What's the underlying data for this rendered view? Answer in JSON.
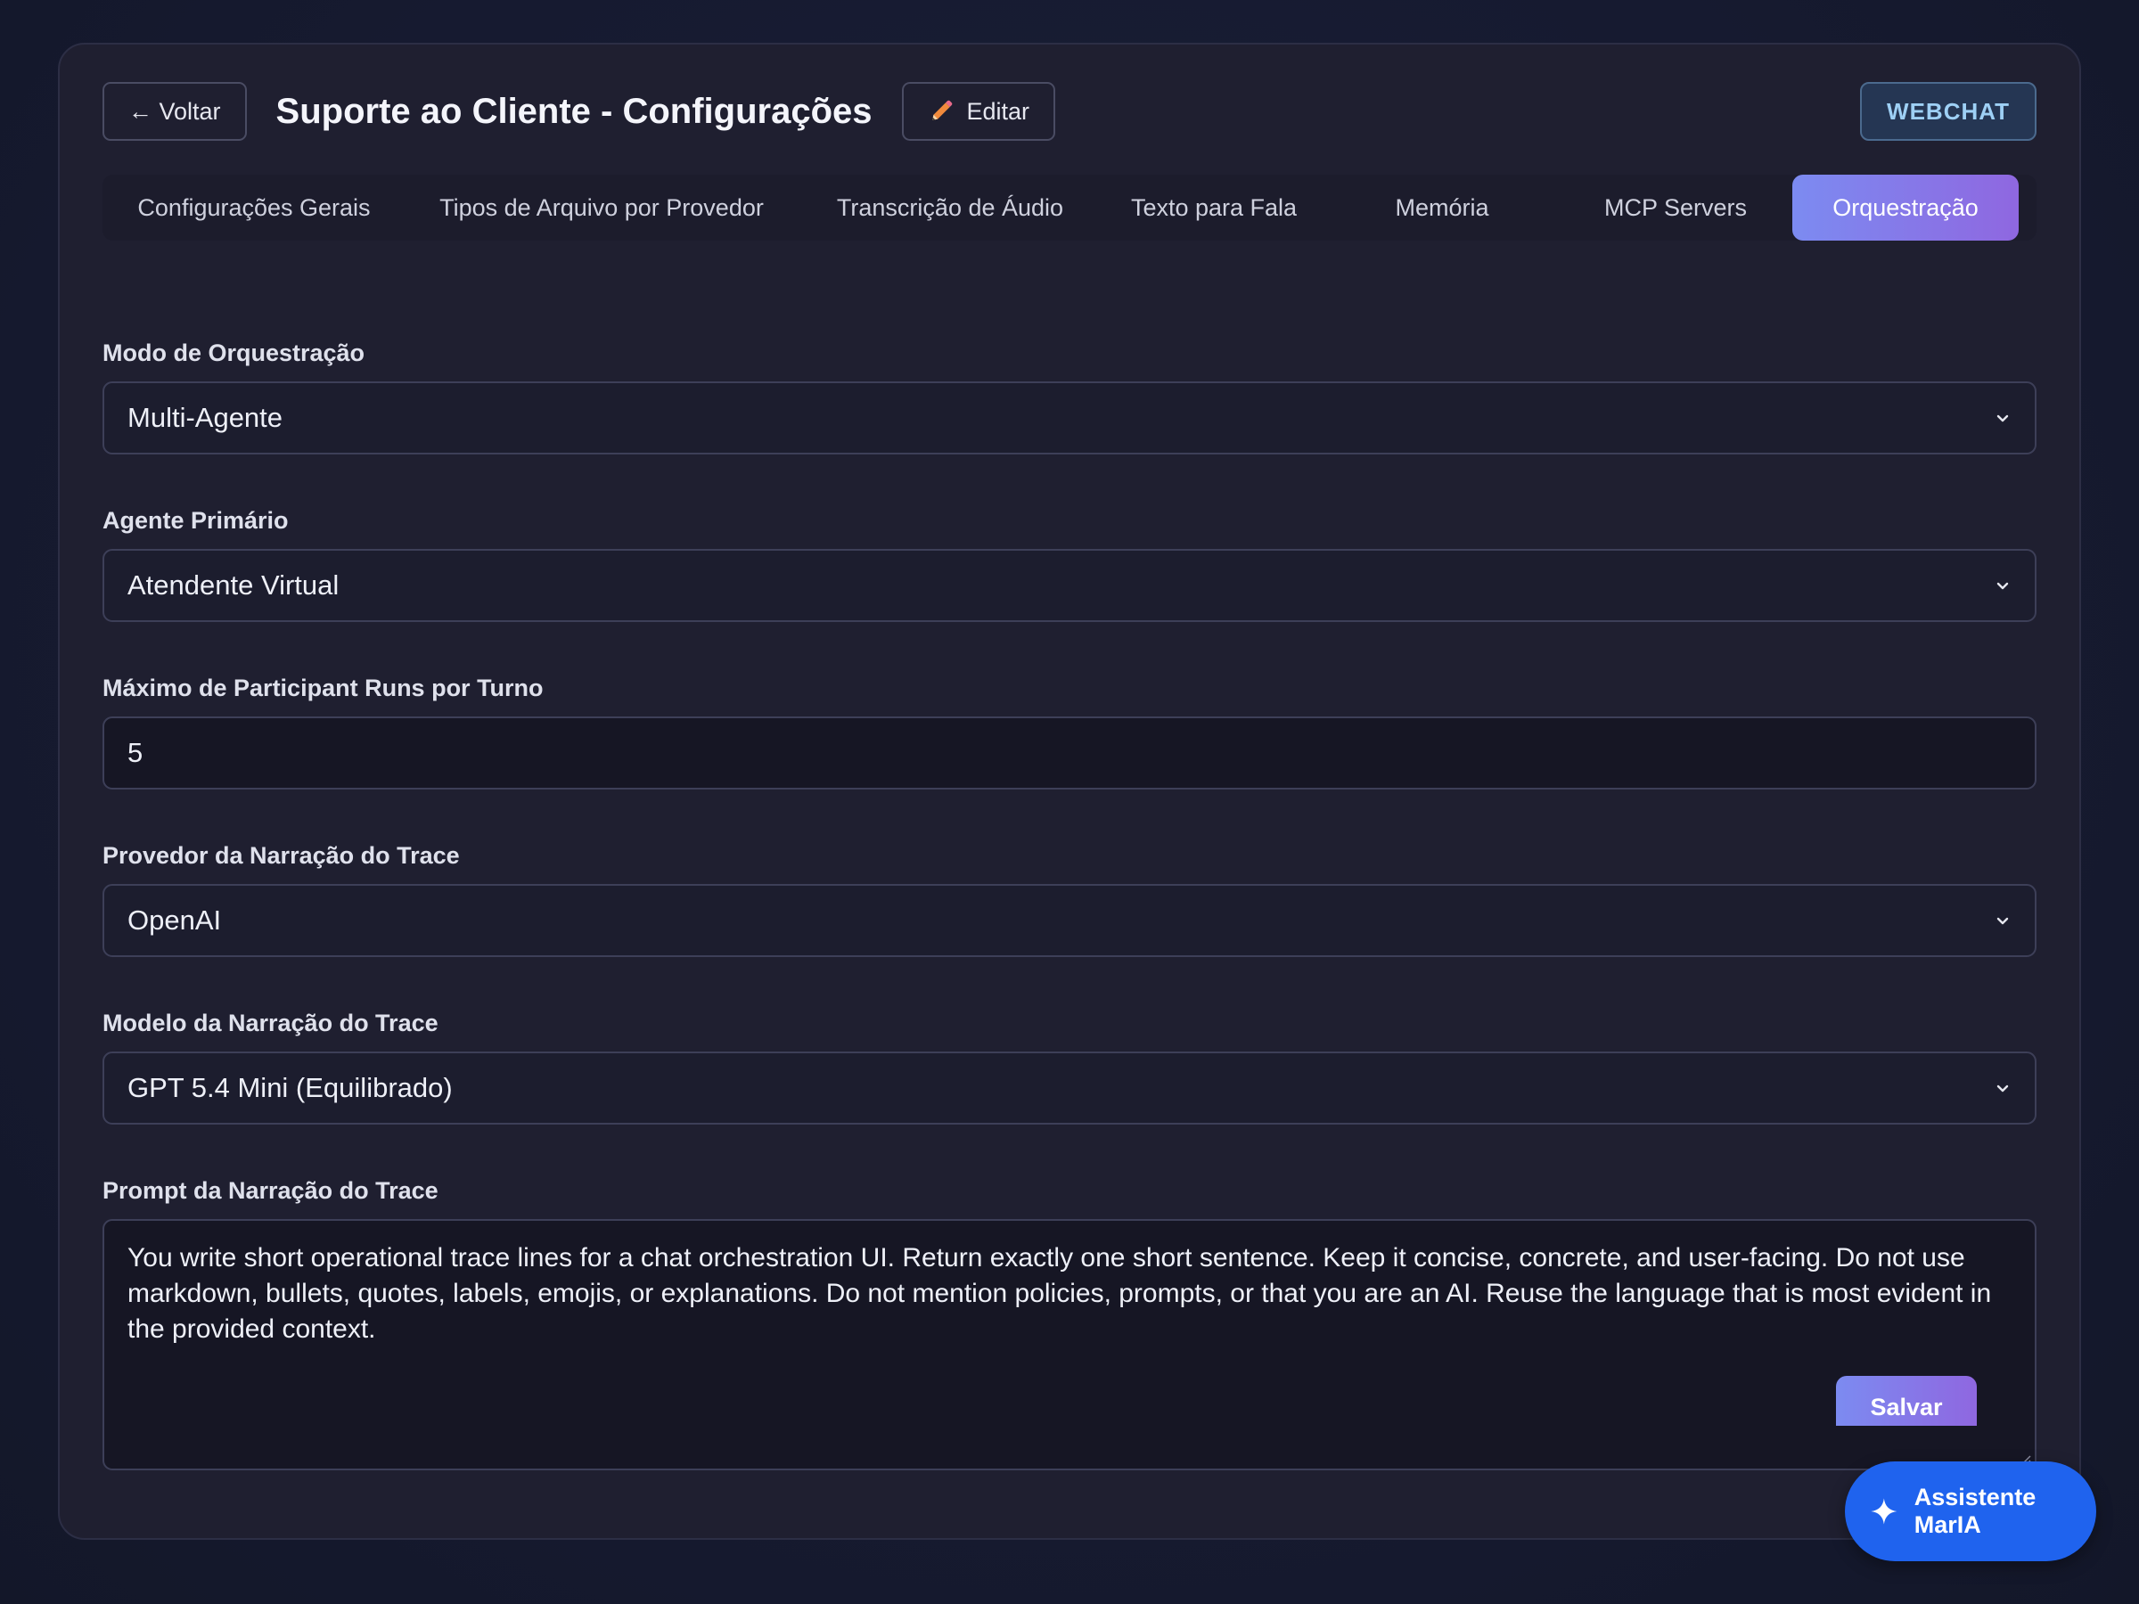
{
  "header": {
    "back_label": "← Voltar",
    "title": "Suporte ao Cliente - Configurações",
    "edit_label": "Editar",
    "channel_badge": "WEBCHAT"
  },
  "tabs": [
    {
      "label": "Configurações Gerais"
    },
    {
      "label": "Tipos de Arquivo por Provedor"
    },
    {
      "label": "Transcrição de Áudio"
    },
    {
      "label": "Texto para Fala"
    },
    {
      "label": "Memória"
    },
    {
      "label": "MCP Servers"
    },
    {
      "label": "Orquestração",
      "active": true
    }
  ],
  "form": {
    "mode": {
      "label": "Modo de Orquestração",
      "value": "Multi-Agente"
    },
    "primary_agent": {
      "label": "Agente Primário",
      "value": "Atendente Virtual"
    },
    "max_runs": {
      "label": "Máximo de Participant Runs por Turno",
      "value": "5"
    },
    "trace_provider": {
      "label": "Provedor da Narração do Trace",
      "value": "OpenAI"
    },
    "trace_model": {
      "label": "Modelo da Narração do Trace",
      "value": "GPT 5.4 Mini (Equilibrado)"
    },
    "trace_prompt": {
      "label": "Prompt da Narração do Trace",
      "value": "You write short operational trace lines for a chat orchestration UI. Return exactly one short sentence. Keep it concise, concrete, and user-facing. Do not use markdown, bullets, quotes, labels, emojis, or explanations. Do not mention policies, prompts, or that you are an AI. Reuse the language that is most evident in the provided context."
    }
  },
  "actions": {
    "save_label": "Salvar",
    "assistant_label": "Assistente MarIA"
  },
  "icons": {
    "edit": "pencil-icon",
    "select": "chevron-down-icon",
    "assistant": "sparkle-icon"
  },
  "colors": {
    "accent_gradient_start": "#7c8bf1",
    "accent_gradient_end": "#8f67e0",
    "assistant_button": "#1f63ee",
    "badge_text": "#9ed0f5"
  }
}
